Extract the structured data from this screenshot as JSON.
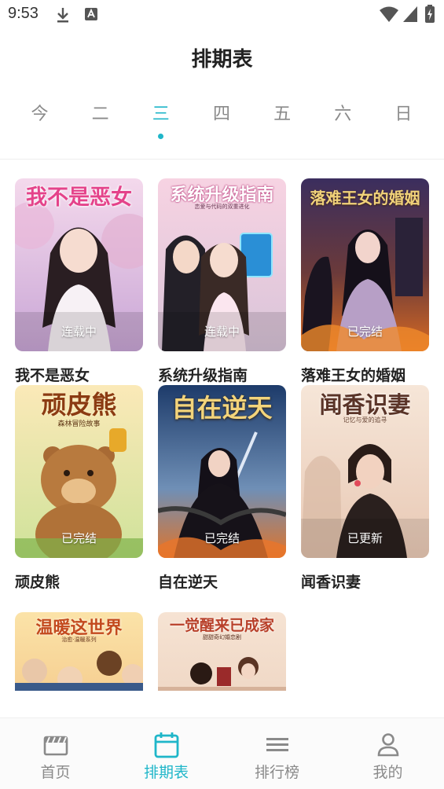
{
  "status_bar": {
    "time": "9:53",
    "icons": [
      "download-icon",
      "app-notification-icon",
      "wifi-icon",
      "signal-icon",
      "battery-charging-icon"
    ]
  },
  "header": {
    "title": "排期表"
  },
  "day_tabs": {
    "items": [
      {
        "label": "今",
        "active": false
      },
      {
        "label": "二",
        "active": false
      },
      {
        "label": "三",
        "active": true
      },
      {
        "label": "四",
        "active": false
      },
      {
        "label": "五",
        "active": false
      },
      {
        "label": "六",
        "active": false
      },
      {
        "label": "日",
        "active": false
      }
    ]
  },
  "comics": [
    {
      "title": "我不是恶女",
      "cover_title": "我不是恶女",
      "cover_subtitle": "",
      "status": "连载中"
    },
    {
      "title": "系统升级指南",
      "cover_title": "系统升级指南",
      "cover_subtitle": "恋爱与代码的双重进化",
      "status": "连载中"
    },
    {
      "title": "落难王女的婚姻",
      "cover_title": "落难王女的婚姻",
      "cover_subtitle": "",
      "status": "已完结"
    },
    {
      "title": "顽皮熊",
      "cover_title": "顽皮熊",
      "cover_subtitle": "森林冒险故事",
      "status": "已完结"
    },
    {
      "title": "自在逆天",
      "cover_title": "自在逆天",
      "cover_subtitle": "",
      "status": "已完结"
    },
    {
      "title": "闻香识妻",
      "cover_title": "闻香识妻",
      "cover_subtitle": "记忆与爱的追寻",
      "status": "已更新"
    },
    {
      "title": "",
      "cover_title": "温暖这世界",
      "cover_subtitle": "治愈·温暖系列",
      "status": ""
    },
    {
      "title": "",
      "cover_title": "一觉醒来已成家",
      "cover_subtitle": "甜甜奇幻婚恋剧",
      "status": ""
    }
  ],
  "bottom_nav": {
    "items": [
      {
        "label": "首页",
        "icon": "clapperboard-icon",
        "active": false
      },
      {
        "label": "排期表",
        "icon": "calendar-icon",
        "active": true
      },
      {
        "label": "排行榜",
        "icon": "ranking-list-icon",
        "active": false
      },
      {
        "label": "我的",
        "icon": "user-icon",
        "active": false
      }
    ]
  },
  "colors": {
    "accent": "#1fb6c9",
    "inactive": "#8a8a8a",
    "text": "#222222"
  }
}
